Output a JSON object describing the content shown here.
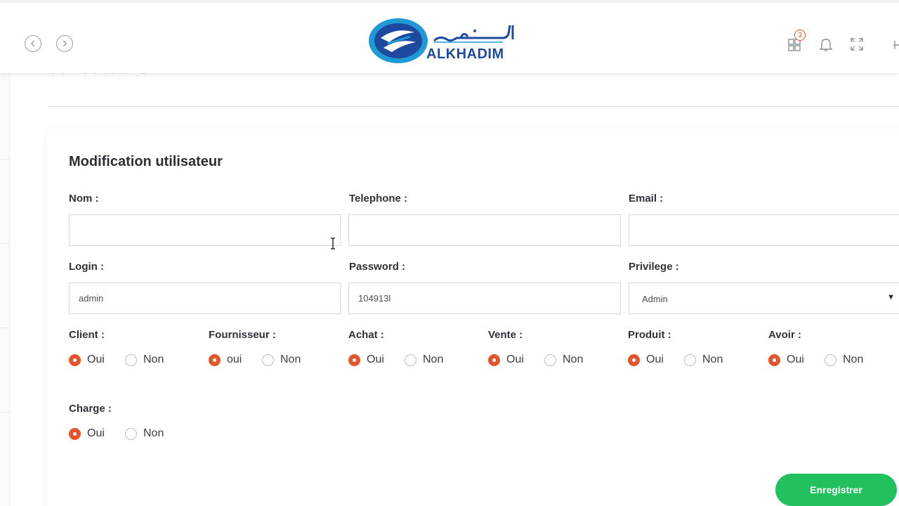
{
  "header": {
    "logo_arabic": "الخـــادم",
    "logo_text": "ALKHADIM",
    "notification_count": "3"
  },
  "page": {
    "heading": "utilisateurs"
  },
  "form": {
    "title": "Modification utilisateur",
    "fields": {
      "nom": {
        "label": "Nom :",
        "value": ""
      },
      "telephone": {
        "label": "Telephone :",
        "value": ""
      },
      "email": {
        "label": "Email :",
        "value": ""
      },
      "login": {
        "label": "Login :",
        "value": "admin"
      },
      "password": {
        "label": "Password :",
        "value": "104913l"
      },
      "privilege": {
        "label": "Privilege :",
        "selected": "Admin"
      }
    },
    "permissions": [
      {
        "label": "Client :",
        "yes": "Oui",
        "no": "Non",
        "selected": "yes"
      },
      {
        "label": "Fournisseur :",
        "yes": "oui",
        "no": "Non",
        "selected": "yes"
      },
      {
        "label": "Achat :",
        "yes": "Oui",
        "no": "Non",
        "selected": "yes"
      },
      {
        "label": "Vente :",
        "yes": "Oui",
        "no": "Non",
        "selected": "yes"
      },
      {
        "label": "Produit :",
        "yes": "Oui",
        "no": "Non",
        "selected": "yes"
      },
      {
        "label": "Avoir :",
        "yes": "Oui",
        "no": "Non",
        "selected": "yes"
      },
      {
        "label": "Charge :",
        "yes": "Oui",
        "no": "Non",
        "selected": "yes"
      }
    ],
    "save_label": "Enregistrer"
  },
  "colors": {
    "accent_radio": "#e4552d",
    "save_button": "#22c15e",
    "logo_blue": "#1d4a9e"
  },
  "icons": [
    "chevron-left-icon",
    "chevron-right-icon",
    "apps-grid-icon",
    "bell-icon",
    "fullscreen-icon"
  ]
}
